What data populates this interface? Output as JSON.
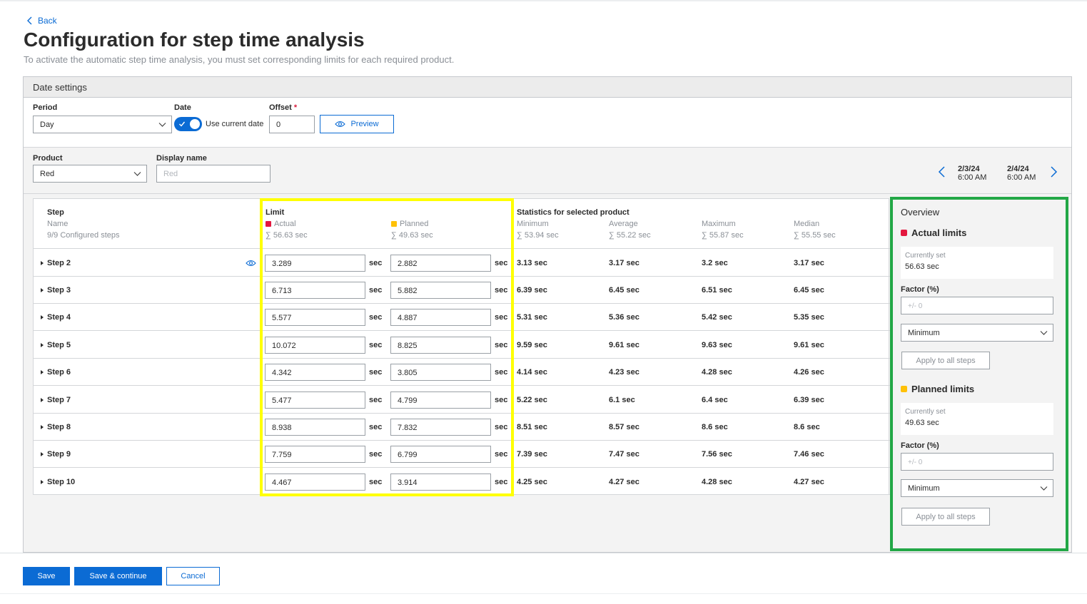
{
  "nav": {
    "back_label": "Back"
  },
  "page": {
    "title": "Configuration for step time analysis",
    "subtitle": "To activate the automatic step time analysis, you must set corresponding limits for each required product."
  },
  "date_settings": {
    "header": "Date settings",
    "period_label": "Period",
    "period_value": "Day",
    "date_label": "Date",
    "use_current_date_label": "Use current date",
    "use_current_date_on": true,
    "offset_label": "Offset",
    "offset_required_mark": "*",
    "offset_value": "0",
    "preview_label": "Preview"
  },
  "product": {
    "product_label": "Product",
    "product_value": "Red",
    "display_name_label": "Display name",
    "display_name_placeholder": "Red",
    "range_start_date": "2/3/24",
    "range_start_time": "6:00 AM",
    "range_end_date": "2/4/24",
    "range_end_time": "6:00 AM"
  },
  "table": {
    "step_header": "Step",
    "name_header": "Name",
    "configured_steps": "9/9 Configured steps",
    "limit_header": "Limit",
    "actual_label": "Actual",
    "actual_sum": "∑ 56.63 sec",
    "planned_label": "Planned",
    "planned_sum": "∑ 49.63 sec",
    "stats_header": "Statistics for selected product",
    "minimum_label": "Minimum",
    "minimum_sum": "∑ 53.94 sec",
    "average_label": "Average",
    "average_sum": "∑ 55.22 sec",
    "maximum_label": "Maximum",
    "maximum_sum": "∑ 55.87 sec",
    "median_label": "Median",
    "median_sum": "∑ 55.55 sec",
    "unit": "sec",
    "rows": [
      {
        "step": "Step 2",
        "actual": "3.289",
        "planned": "2.882",
        "min": "3.13 sec",
        "avg": "3.17 sec",
        "max": "3.2 sec",
        "median": "3.17 sec"
      },
      {
        "step": "Step 3",
        "actual": "6.713",
        "planned": "5.882",
        "min": "6.39 sec",
        "avg": "6.45 sec",
        "max": "6.51 sec",
        "median": "6.45 sec"
      },
      {
        "step": "Step 4",
        "actual": "5.577",
        "planned": "4.887",
        "min": "5.31 sec",
        "avg": "5.36 sec",
        "max": "5.42 sec",
        "median": "5.35 sec"
      },
      {
        "step": "Step 5",
        "actual": "10.072",
        "planned": "8.825",
        "min": "9.59 sec",
        "avg": "9.61 sec",
        "max": "9.63 sec",
        "median": "9.61 sec"
      },
      {
        "step": "Step 6",
        "actual": "4.342",
        "planned": "3.805",
        "min": "4.14 sec",
        "avg": "4.23 sec",
        "max": "4.28 sec",
        "median": "4.26 sec"
      },
      {
        "step": "Step 7",
        "actual": "5.477",
        "planned": "4.799",
        "min": "5.22 sec",
        "avg": "6.1 sec",
        "max": "6.4 sec",
        "median": "6.39 sec"
      },
      {
        "step": "Step 8",
        "actual": "8.938",
        "planned": "7.832",
        "min": "8.51 sec",
        "avg": "8.57 sec",
        "max": "8.6 sec",
        "median": "8.6 sec"
      },
      {
        "step": "Step 9",
        "actual": "7.759",
        "planned": "6.799",
        "min": "7.39 sec",
        "avg": "7.47 sec",
        "max": "7.56 sec",
        "median": "7.46 sec"
      },
      {
        "step": "Step 10",
        "actual": "4.467",
        "planned": "3.914",
        "min": "4.25 sec",
        "avg": "4.27 sec",
        "max": "4.28 sec",
        "median": "4.27 sec"
      }
    ]
  },
  "overview": {
    "title": "Overview",
    "actual": {
      "title": "Actual limits",
      "currently_set_label": "Currently set",
      "currently_set_value": "56.63 sec",
      "factor_label": "Factor (%)",
      "factor_placeholder": "+/- 0",
      "mode_value": "Minimum",
      "apply_label": "Apply to all steps"
    },
    "planned": {
      "title": "Planned limits",
      "currently_set_label": "Currently set",
      "currently_set_value": "49.63 sec",
      "factor_label": "Factor (%)",
      "factor_placeholder": "+/- 0",
      "mode_value": "Minimum",
      "apply_label": "Apply to all steps"
    }
  },
  "footer": {
    "save_label": "Save",
    "save_continue_label": "Save & continue",
    "cancel_label": "Cancel"
  },
  "colors": {
    "accent": "#0b6bd4",
    "actual_marker": "#e3173e",
    "planned_marker": "#ffc107",
    "highlight_yellow": "#ffff00",
    "highlight_green": "#22a746"
  }
}
